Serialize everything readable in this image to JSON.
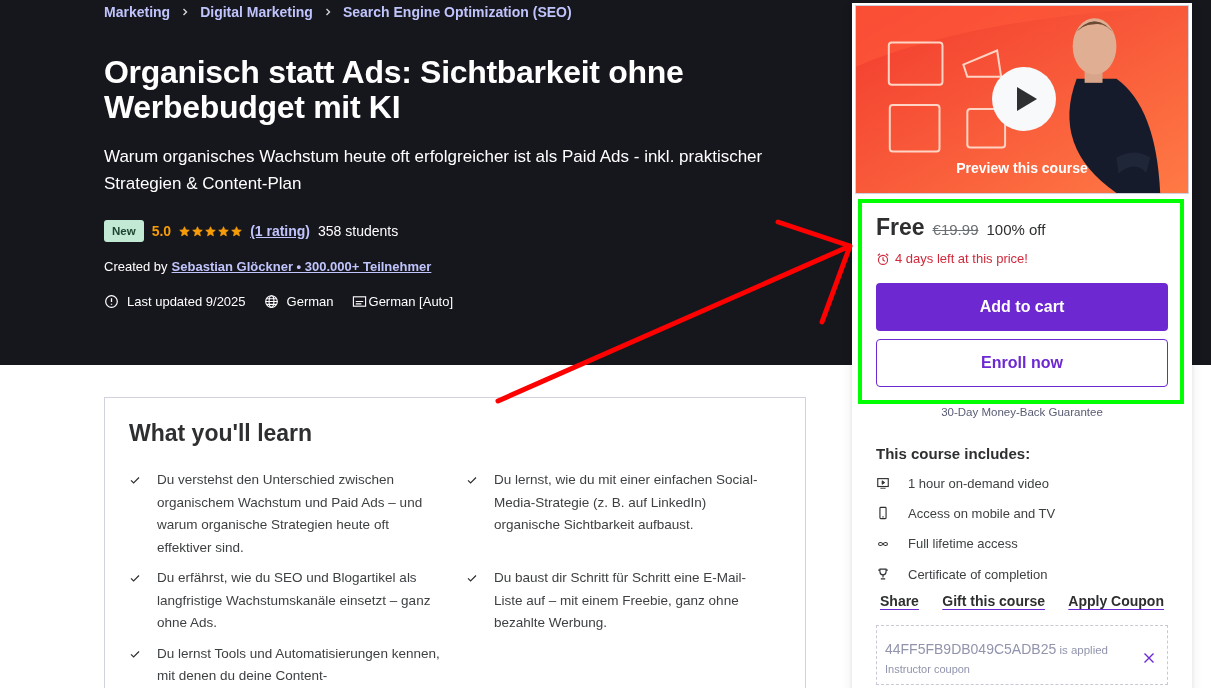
{
  "breadcrumb": [
    {
      "label": "Marketing"
    },
    {
      "label": "Digital Marketing"
    },
    {
      "label": "Search Engine Optimization (SEO)"
    }
  ],
  "title": "Organisch statt Ads: Sichtbarkeit ohne Werbebudget mit KI",
  "subtitle": "Warum organisches Wachstum heute oft erfolgreicher ist als Paid Ads - inkl. praktischer Strategien & Content-Plan",
  "badge": "New",
  "rating": "5.0",
  "stars": 5,
  "rating_link": "(1 rating)",
  "students": "358 students",
  "created_by": {
    "label": "Created by",
    "instructor": "Sebastian Glöckner • 300.000+ Teilnehmer"
  },
  "meta": {
    "last_updated": "Last updated 9/2025",
    "language": "German",
    "captions": "German [Auto]"
  },
  "learn": {
    "title": "What you'll learn",
    "items": [
      {
        "text": "Du verstehst den Unterschied zwischen organischem Wachstum und Paid Ads – und warum organische Strategien heute oft effektiver sind."
      },
      {
        "text": "Du lernst, wie du mit einer einfachen Social-Media-Strategie (z. B. auf LinkedIn) organische Sichtbarkeit aufbaust."
      },
      {
        "text": "Du erfährst, wie du SEO und Blogartikel als langfristige Wachstumskanäle einsetzt – ganz ohne Ads."
      },
      {
        "text": "Du baust dir Schritt für Schritt eine E-Mail-Liste auf – mit einem Freebie, ganz ohne bezahlte Werbung."
      },
      {
        "text": "Du lernst Tools und Automatisierungen kennen, mit denen du deine Content-"
      }
    ]
  },
  "sidebar": {
    "preview": {
      "kind": "picture",
      "label": "Preview this course"
    },
    "price": "Free",
    "original_price": "€19.99",
    "discount": "100% off",
    "timer": "4 days left at this price!",
    "buttons": [
      {
        "label": "Add to cart",
        "kind": "primary"
      },
      {
        "label": "Enroll now",
        "kind": "secondary"
      }
    ],
    "guarantee": "30-Day Money-Back Guarantee",
    "includes_title": "This course includes:",
    "includes": [
      {
        "kind": "video",
        "text": "1 hour on-demand video"
      },
      {
        "kind": "mobile",
        "text": "Access on mobile and TV"
      },
      {
        "kind": "infinity",
        "text": "Full lifetime access"
      },
      {
        "kind": "trophy",
        "text": "Certificate of completion"
      }
    ],
    "links": [
      {
        "label": "Share"
      },
      {
        "label": "Gift this course"
      },
      {
        "label": "Apply Coupon"
      }
    ],
    "coupon": {
      "code": "44FF5FB9DB049C5ADB25",
      "status": "is applied",
      "note": "Instructor coupon"
    }
  }
}
